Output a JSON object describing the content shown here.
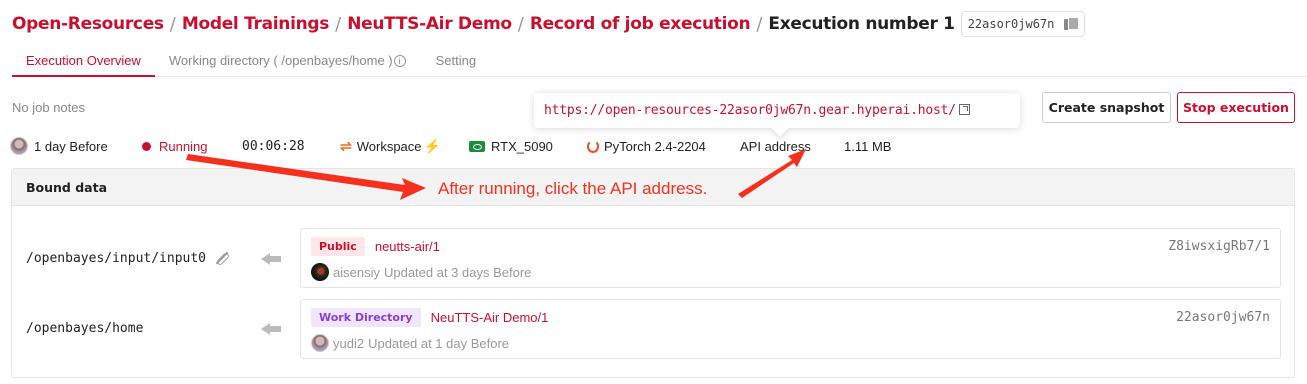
{
  "breadcrumb": {
    "items": [
      "Open-Resources",
      "Model Trainings",
      "NeuTTS-Air Demo",
      "Record of job execution"
    ],
    "separator": "/",
    "current": "Execution number 1",
    "id": "22asor0jw67n"
  },
  "tabs": [
    {
      "label": "Execution Overview",
      "active": true
    },
    {
      "label": "Working directory ( /openbayes/home )",
      "active": false
    },
    {
      "label": "Setting",
      "active": false
    }
  ],
  "notes": "No job notes",
  "api_tooltip": {
    "url": "https://open-resources-22asor0jw67n.gear.hyperai.host/"
  },
  "actions": {
    "snapshot": "Create snapshot",
    "stop": "Stop execution"
  },
  "meta": {
    "started": "1 day Before",
    "status": "Running",
    "duration": "00:06:28",
    "workspace": "Workspace",
    "gpu": "RTX_5090",
    "framework": "PyTorch 2.4-2204",
    "api_label": "API address",
    "size": "1.11 MB"
  },
  "annotation": "After running, click the API address.",
  "bound_data": {
    "title": "Bound data",
    "items": [
      {
        "mount": "/openbayes/input/input0",
        "badge": "Public",
        "name": "neutts-air/1",
        "id": "Z8iwsxigRb7/1",
        "user": "aisensiy",
        "updated": "Updated at 3 days Before"
      },
      {
        "mount": "/openbayes/home",
        "badge": "Work Directory",
        "name": "NeuTTS-Air Demo/1",
        "id": "22asor0jw67n",
        "user": "yudi2",
        "updated": "Updated at 1 day Before"
      }
    ]
  },
  "colors": {
    "accent": "#c8102e",
    "annotation": "#f5301d"
  }
}
